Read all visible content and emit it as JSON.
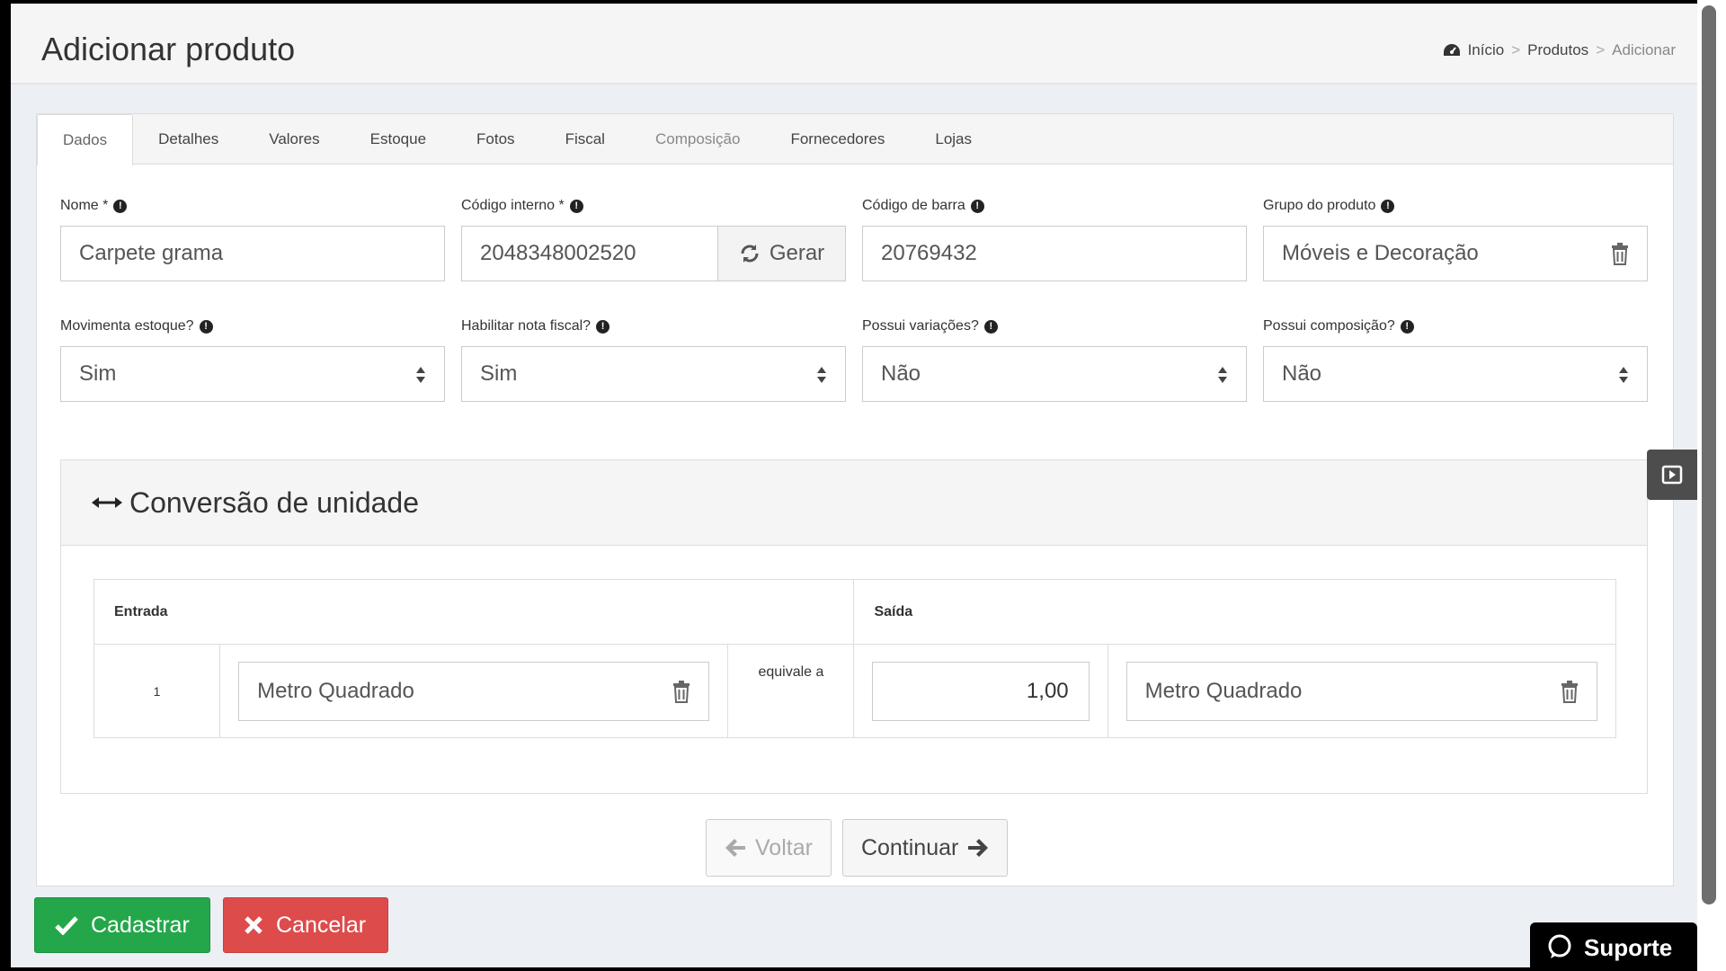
{
  "header": {
    "title": "Adicionar produto",
    "breadcrumb": [
      "Início",
      "Produtos",
      "Adicionar"
    ],
    "breadcrumb_sep": ">"
  },
  "tabs": [
    "Dados",
    "Detalhes",
    "Valores",
    "Estoque",
    "Fotos",
    "Fiscal",
    "Composição",
    "Fornecedores",
    "Lojas"
  ],
  "fields": {
    "nome": {
      "label": "Nome *",
      "value": "Carpete grama"
    },
    "codigo_interno": {
      "label": "Código interno *",
      "value": "2048348002520",
      "button": "Gerar"
    },
    "codigo_barra": {
      "label": "Código de barra",
      "value": "20769432"
    },
    "grupo": {
      "label": "Grupo do produto",
      "value": "Móveis e Decoração"
    },
    "movimenta_estoque": {
      "label": "Movimenta estoque?",
      "value": "Sim"
    },
    "nota_fiscal": {
      "label": "Habilitar nota fiscal?",
      "value": "Sim"
    },
    "variacoes": {
      "label": "Possui variações?",
      "value": "Não"
    },
    "composicao": {
      "label": "Possui composição?",
      "value": "Não"
    }
  },
  "conversao": {
    "title": "Conversão de unidade",
    "entrada_header": "Entrada",
    "saida_header": "Saída",
    "quantity": "1",
    "entrada_unit": "Metro Quadrado",
    "equivale": "equivale a",
    "saida_value": "1,00",
    "saida_unit": "Metro Quadrado"
  },
  "nav": {
    "back": "Voltar",
    "next": "Continuar"
  },
  "actions": {
    "save": "Cadastrar",
    "cancel": "Cancelar"
  },
  "support": {
    "label": "Suporte"
  },
  "colors": {
    "success": "#24a74a",
    "danger": "#dd4b4b"
  }
}
